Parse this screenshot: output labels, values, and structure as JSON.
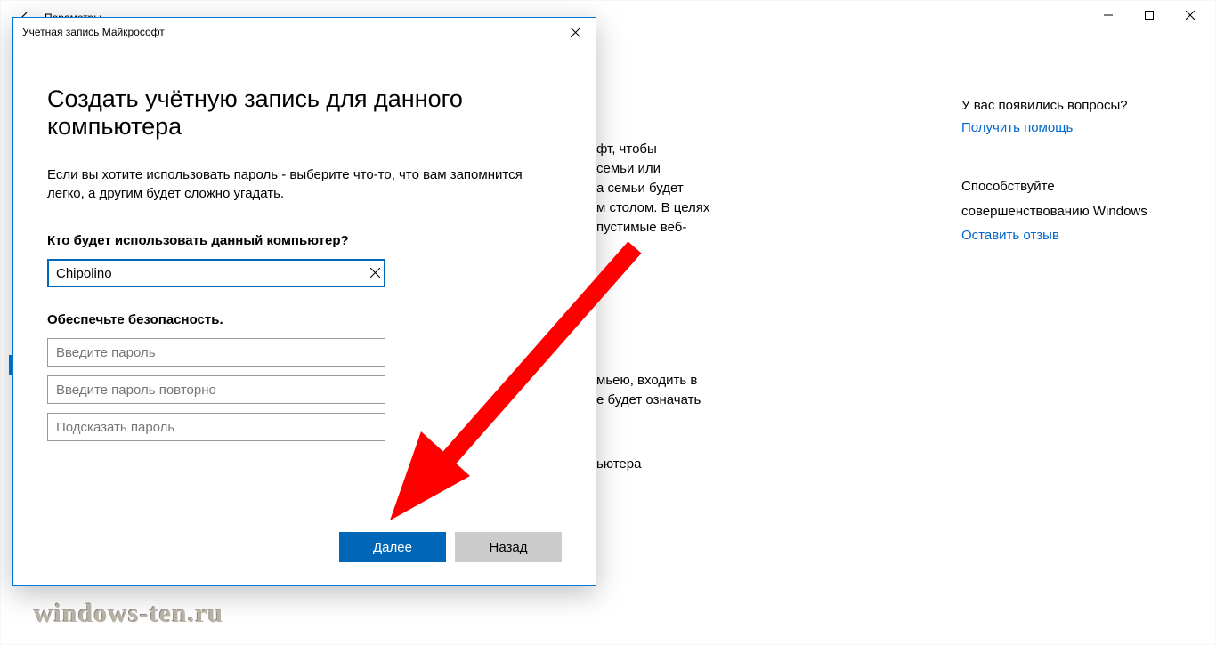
{
  "bg": {
    "title": "Параметры",
    "p1": "фт, чтобы\nсемьи или\nа семьи будет\nм столом. В целях\nпустимые веб-",
    "p2": "мьею, входить в\nе будет означать",
    "p3": "ьютера",
    "right": {
      "q": "У вас появились вопросы?",
      "help_link": "Получить помощь",
      "improve1": "Способствуйте",
      "improve2": "совершенствованию Windows",
      "feedback_link": "Оставить отзыв"
    }
  },
  "modal": {
    "title": "Учетная запись Майкрософт",
    "heading": "Создать учётную запись для данного компьютера",
    "desc": "Если вы хотите использовать пароль - выберите что-то, что вам запомнится легко, а другим будет сложно угадать.",
    "who_label": "Кто будет использовать данный компьютер?",
    "username_value": "Chipolino",
    "safety_label": "Обеспечьте безопасность.",
    "pw_placeholder": "Введите пароль",
    "pw2_placeholder": "Введите пароль повторно",
    "hint_placeholder": "Подсказать пароль",
    "next": "Далее",
    "back": "Назад"
  },
  "watermark": "windows-ten.ru"
}
